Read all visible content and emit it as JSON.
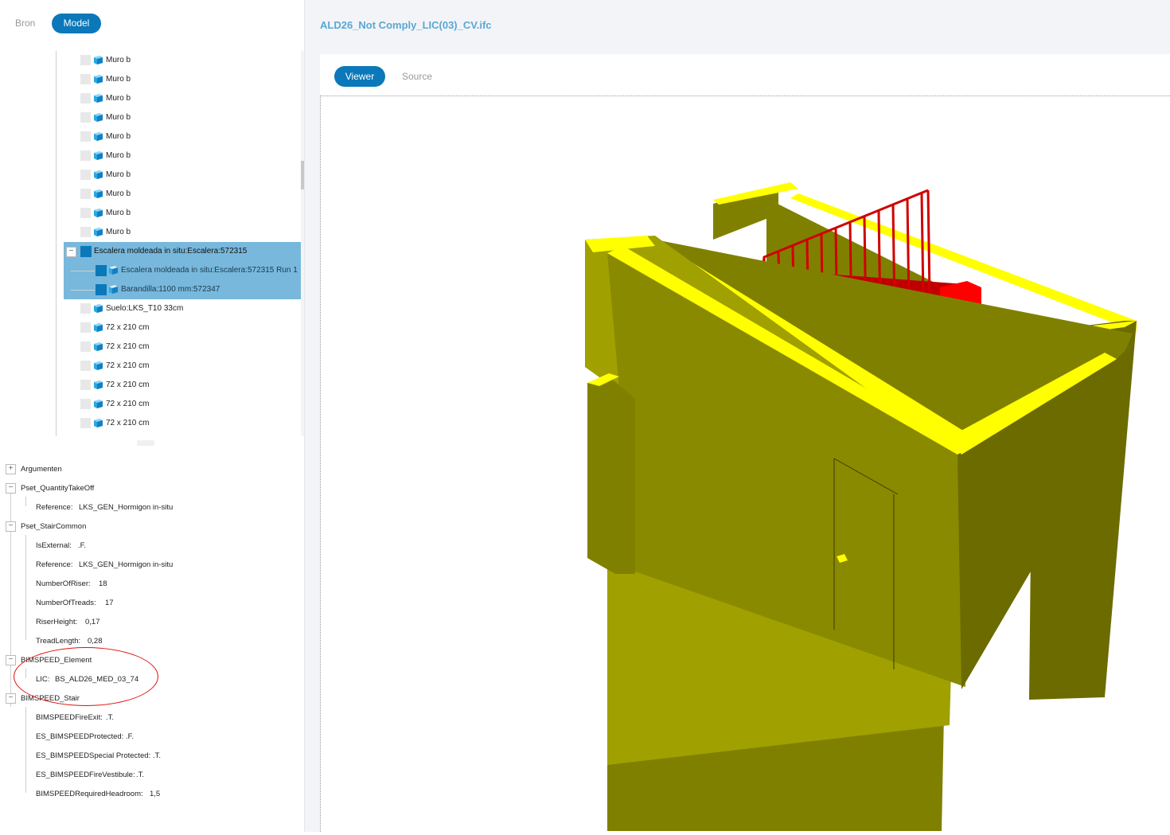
{
  "top_tabs": {
    "bron": "Bron",
    "model": "Model"
  },
  "tree": {
    "walls": [
      "Muro b",
      "Muro b",
      "Muro b",
      "Muro b",
      "Muro b",
      "Muro b",
      "Muro b",
      "Muro b",
      "Muro b",
      "Muro b"
    ],
    "selected_parent": "Escalera moldeada in situ:Escalera:572315",
    "selected_children": [
      "Escalera moldeada in situ:Escalera:572315 Run 1",
      "Barandilla:1100 mm:572347"
    ],
    "after": [
      "Suelo:LKS_T10 33cm",
      "72 x 210 cm",
      "72 x 210 cm",
      "72 x 210 cm",
      "72 x 210 cm",
      "72 x 210 cm",
      "72 x 210 cm"
    ]
  },
  "props": {
    "argumenten": "Argumenten",
    "pset_qto": "Pset_QuantityTakeOff",
    "qto_ref_key": "Reference:",
    "qto_ref_val": "LKS_GEN_Hormigon in-situ",
    "pset_stair": "Pset_StairCommon",
    "stair_props": [
      {
        "k": "IsExternal:",
        "v": ".F."
      },
      {
        "k": "Reference:",
        "v": "LKS_GEN_Hormigon in-situ"
      },
      {
        "k": "NumberOfRiser:",
        "v": "18"
      },
      {
        "k": "NumberOfTreads:",
        "v": "17"
      },
      {
        "k": "RiserHeight:",
        "v": "0,17"
      },
      {
        "k": "TreadLength:",
        "v": "0,28"
      }
    ],
    "bimspeed_element": "BIMSPEED_Element",
    "lic_key": "LIC:",
    "lic_val": "BS_ALD26_MED_03_74",
    "bimspeed_stair": "BIMSPEED_Stair",
    "bs_props": [
      {
        "k": "BIMSPEEDFireExit:",
        "v": ".T."
      },
      {
        "k": "ES_BIMSPEEDProtected:",
        "v": ".F."
      },
      {
        "k": "ES_BIMSPEEDSpecial Protected:",
        "v": ".T."
      },
      {
        "k": "ES_BIMSPEEDFireVestibule:",
        "v": ".T."
      },
      {
        "k": "BIMSPEEDRequiredHeadroom:",
        "v": "1,5"
      }
    ]
  },
  "file_title": "ALD26_Not Comply_LIC(03)_CV.ifc",
  "viewer_tabs": {
    "viewer": "Viewer",
    "source": "Source"
  },
  "colors": {
    "accent": "#0b78b9",
    "wall": "#808000",
    "wall_top": "#ffff00",
    "stair": "#ff0000",
    "annotation": "#dd1111"
  }
}
